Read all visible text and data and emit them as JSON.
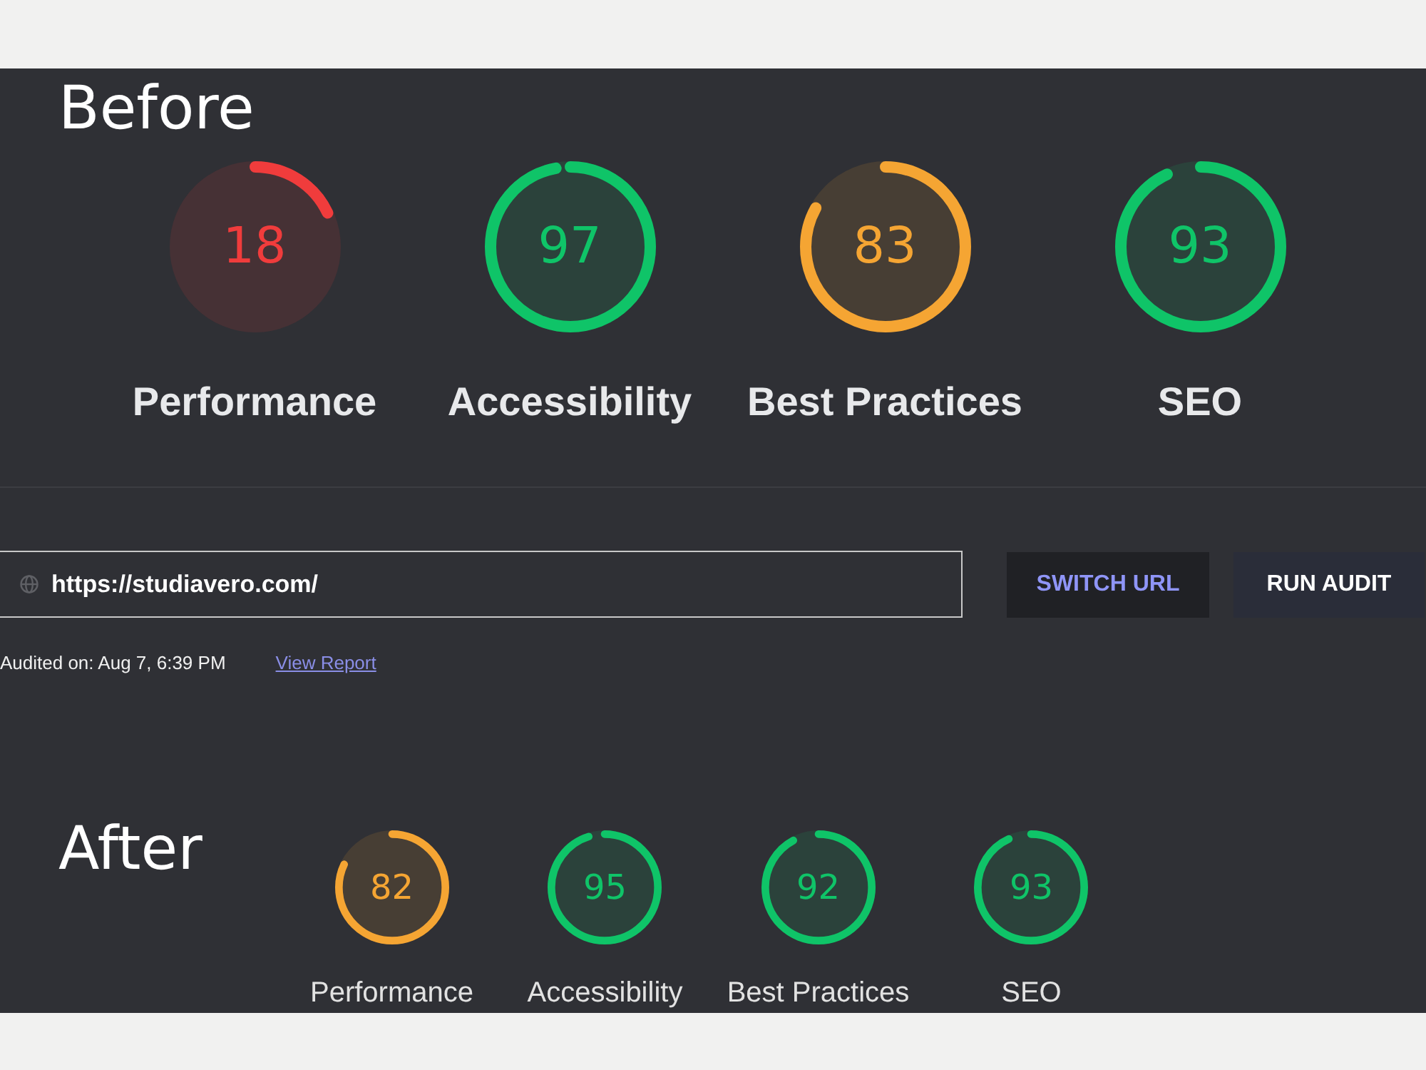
{
  "before": {
    "heading": "Before",
    "gauges": [
      {
        "label": "Performance",
        "score": "18",
        "level": 0.18,
        "color": "#f03c3c"
      },
      {
        "label": "Accessibility",
        "score": "97",
        "level": 0.97,
        "color": "#0fc468"
      },
      {
        "label": "Best Practices",
        "score": "83",
        "level": 0.83,
        "color": "#f5a533"
      },
      {
        "label": "SEO",
        "score": "93",
        "level": 0.93,
        "color": "#0fc468"
      }
    ]
  },
  "audit": {
    "url_field": {
      "value": "https://studiavero.com/"
    },
    "buttons": [
      {
        "label": "SWITCH URL",
        "kind": "secondary"
      },
      {
        "label": "RUN AUDIT",
        "kind": "primary"
      }
    ],
    "audited_on": "Audited on: Aug 7, 6:39 PM",
    "report_link": "View Report"
  },
  "after": {
    "heading": "After",
    "gauges": [
      {
        "label": "Performance",
        "score": "82",
        "level": 0.82,
        "color": "#f5a533"
      },
      {
        "label": "Accessibility",
        "score": "95",
        "level": 0.95,
        "color": "#0fc468"
      },
      {
        "label": "Best Practices",
        "score": "92",
        "level": 0.92,
        "color": "#0fc468"
      },
      {
        "label": "SEO",
        "score": "93",
        "level": 0.93,
        "color": "#0fc468"
      }
    ]
  }
}
